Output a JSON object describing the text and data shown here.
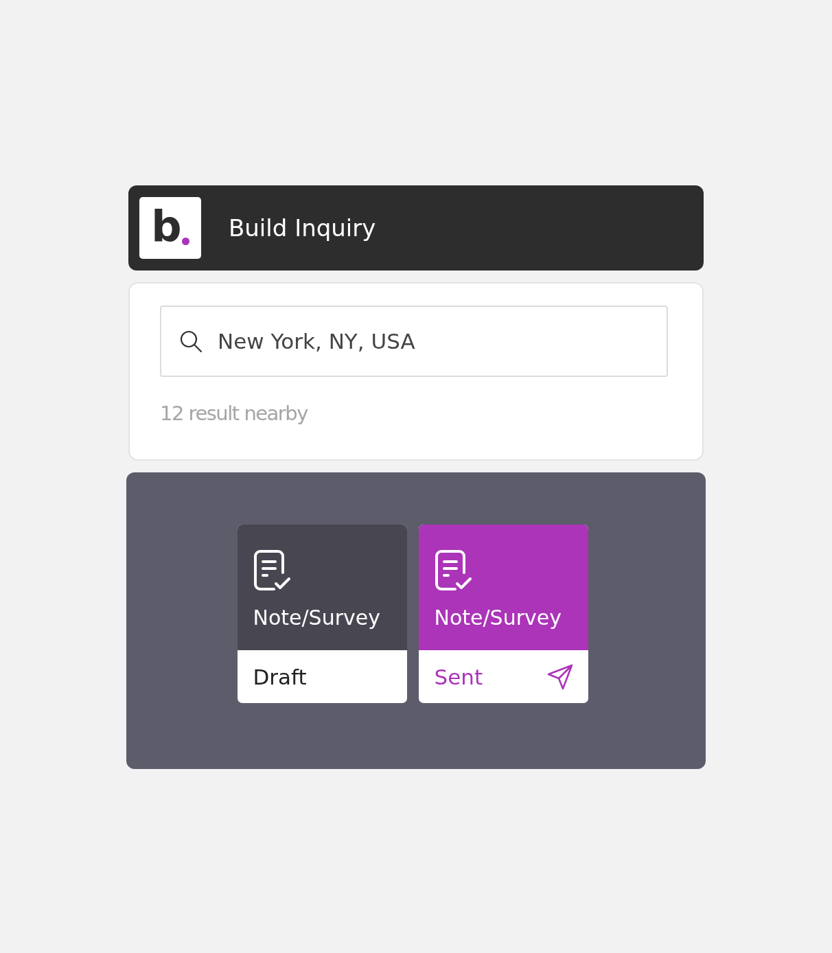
{
  "header": {
    "logo": "b",
    "title": "Build Inquiry"
  },
  "search": {
    "value": "New York, NY, USA"
  },
  "results": "12 result nearby",
  "cards": [
    {
      "title": "Note/Survey",
      "status": "Draft",
      "kind": "draft",
      "selected": false
    },
    {
      "title": "Note/Survey",
      "status": "Sent",
      "kind": "sent",
      "selected": true
    }
  ]
}
